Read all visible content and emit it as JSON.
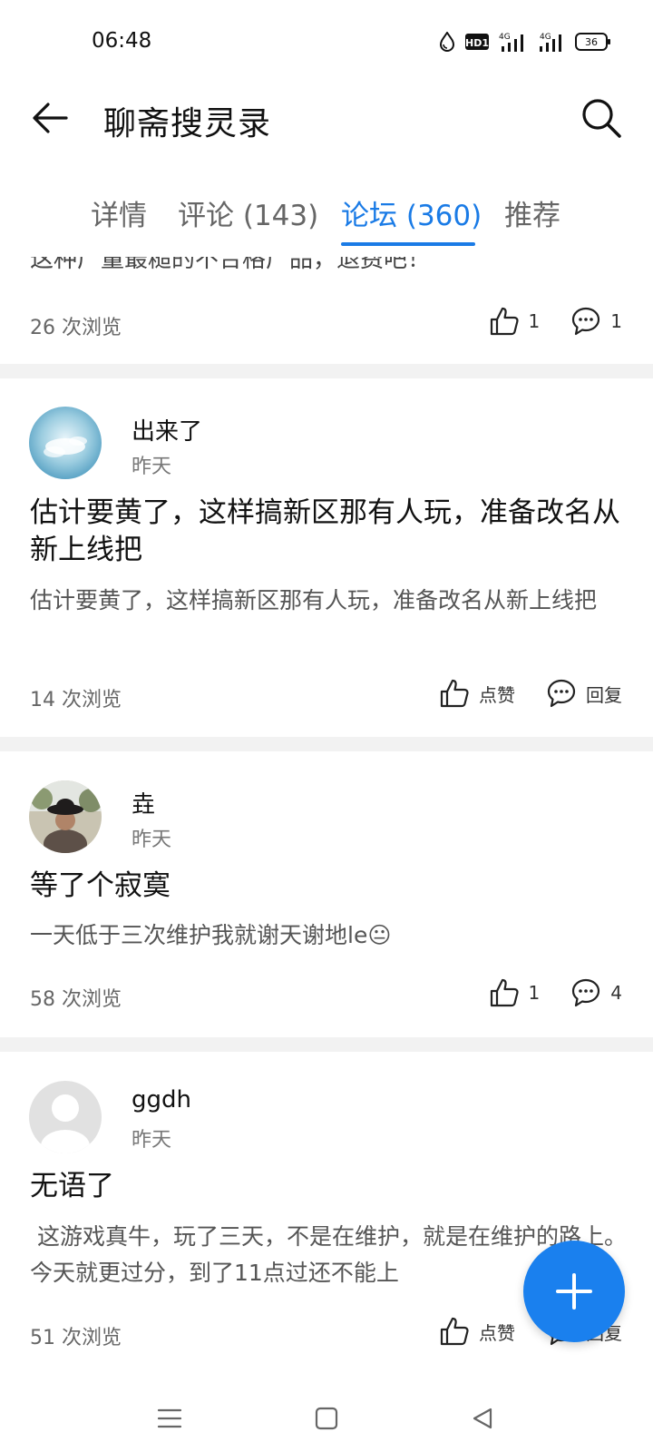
{
  "status_bar": {
    "time": "06:48",
    "battery": "36",
    "hd_label": "HD1",
    "net_label_1": "4G",
    "net_label_2": "4G",
    "icons": [
      "water-drop-icon",
      "hd-icon",
      "signal-icon",
      "signal-icon",
      "battery-icon"
    ]
  },
  "header": {
    "title": "聊斋搜灵录",
    "back_icon": "arrow-left-icon",
    "search_icon": "search-icon"
  },
  "tabs": [
    {
      "label": "详情"
    },
    {
      "label": "评论 (143)"
    },
    {
      "label": "论坛 (360)",
      "active": true
    },
    {
      "label": "推荐"
    }
  ],
  "partial_post": {
    "text_fragment": "这种广量最糙的不合格广品，退费吧！",
    "views": "26 次浏览",
    "likes": "1",
    "replies": "1"
  },
  "posts": [
    {
      "author": "出来了",
      "time": "昨天",
      "title": "估计要黄了，这样搞新区那有人玩，准备改名从新上线把",
      "body": "估计要黄了，这样搞新区那有人玩，准备改名从新上线把",
      "views": "14 次浏览",
      "like_label": "点赞",
      "reply_label": "回复"
    },
    {
      "author": "垚",
      "time": "昨天",
      "title": "等了个寂寞",
      "body": "一天低于三次维护我就谢天谢地le😐",
      "views": "58 次浏览",
      "like_label": "1",
      "reply_label": "4"
    },
    {
      "author": "ggdh",
      "time": "昨天",
      "title": "无语了",
      "body": " 这游戏真牛，玩了三天，不是在维护，就是在维护的路上。今天就更过分，到了11点过还不能上",
      "views": "51 次浏览",
      "like_label": "点赞",
      "reply_label": "回复"
    }
  ],
  "fab": {
    "icon": "plus-icon"
  },
  "nav_bar": {
    "icons": [
      "menu-icon",
      "home-square-icon",
      "back-triangle-icon"
    ]
  },
  "colors": {
    "accent": "#1a7be6",
    "fab": "#1a80ee",
    "divider": "#f2f2f2"
  }
}
